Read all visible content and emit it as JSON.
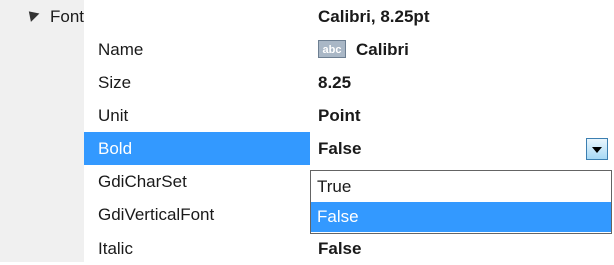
{
  "property_grid": {
    "group": {
      "label": "Font",
      "value": "Calibri, 8.25pt",
      "expander_icon": "collapse-triangle-icon"
    },
    "properties": [
      {
        "name": "Name",
        "value": "Calibri",
        "icon": "abc",
        "selected": false
      },
      {
        "name": "Size",
        "value": "8.25",
        "selected": false
      },
      {
        "name": "Unit",
        "value": "Point",
        "selected": false
      },
      {
        "name": "Bold",
        "value": "False",
        "selected": true
      },
      {
        "name": "GdiCharSet",
        "value": "",
        "selected": false
      },
      {
        "name": "GdiVerticalFont",
        "value": "",
        "selected": false
      },
      {
        "name": "Italic",
        "value": "False",
        "selected": false
      }
    ],
    "bold_dropdown": {
      "options": [
        "True",
        "False"
      ],
      "selected": "False"
    }
  },
  "colors": {
    "selection": "#3399ff",
    "gutter": "#f0f0f0"
  }
}
